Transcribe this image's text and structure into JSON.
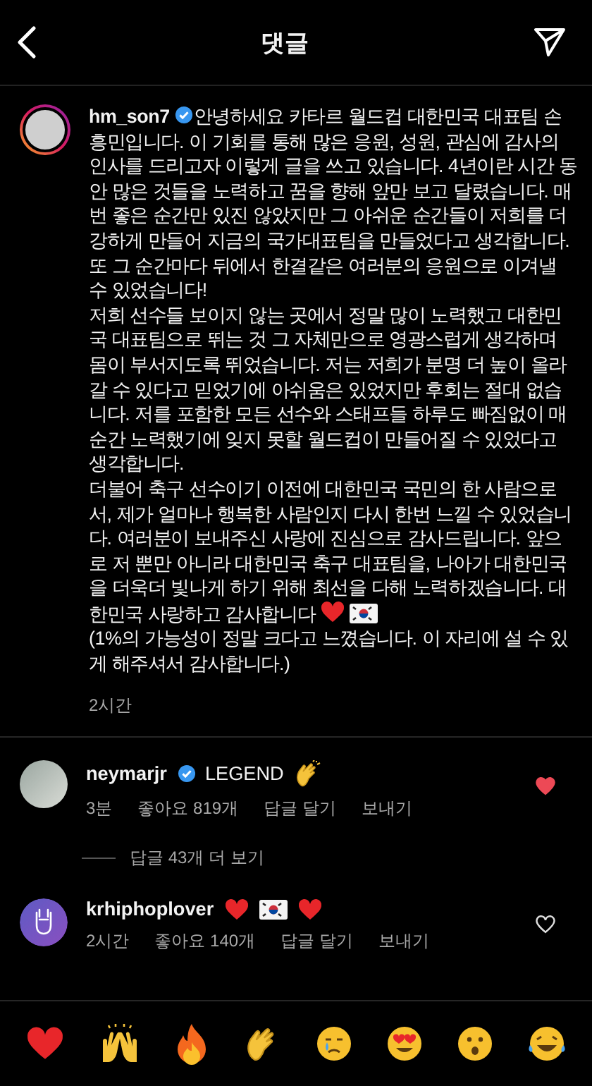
{
  "header": {
    "title": "댓글"
  },
  "post": {
    "username": "hm_son7",
    "verified": true,
    "paragraphs": [
      "안녕하세요 카타르 월드컵 대한민국 대표팀 손흥민입니다. 이 기회를 통해 많은 응원, 성원, 관심에 감사의 인사를 드리고자 이렇게 글을 쓰고 있습니다. 4년이란 시간 동안 많은 것들을 노력하고 꿈을 향해 앞만 보고 달렸습니다. 매번 좋은 순간만 있진 않았지만 그 아쉬운 순간들이 저희를 더 강하게 만들어 지금의 국가대표팀을 만들었다고 생각합니다. 또 그 순간마다 뒤에서 한결같은 여러분의 응원으로 이겨낼 수 있었습니다!",
      "저희 선수들 보이지 않는 곳에서 정말 많이 노력했고 대한민국 대표팀으로 뛰는 것 그 자체만으로 영광스럽게 생각하며 몸이 부서지도록 뛰었습니다. 저는 저희가 분명 더 높이 올라갈 수 있다고 믿었기에 아쉬움은 있었지만 후회는 절대 없습니다. 저를 포함한 모든 선수와 스태프들 하루도 빠짐없이 매 순간 노력했기에 잊지 못할 월드컵이 만들어질 수 있었다고 생각합니다.",
      "더불어 축구 선수이기 이전에 대한민국 국민의 한 사람으로서, 제가 얼마나 행복한 사람인지 다시 한번 느낄 수 있었습니다. 여러분이 보내주신 사랑에 진심으로 감사드립니다. 앞으로 저 뿐만 아니라 대한민국 축구 대표팀을, 나아가 대한민국을 더욱더 빛나게 하기 위해 최선을 다해 노력하겠습니다. 대한민국 사랑하고 감사합니다",
      "(1%의 가능성이 정말 크다고 느꼈습니다. 이 자리에 설 수 있게 해주셔서 감사합니다.)"
    ],
    "time": "2시간"
  },
  "comments": [
    {
      "username": "neymarjr",
      "verified": true,
      "text": "LEGEND",
      "time": "3분",
      "likes": "좋아요 819개",
      "reply": "답글 달기",
      "send": "보내기",
      "liked": true,
      "more_replies": "답글 43개 더 보기"
    },
    {
      "username": "krhiphoplover",
      "verified": false,
      "time": "2시간",
      "likes": "좋아요 140개",
      "reply": "답글 달기",
      "send": "보내기",
      "liked": false
    }
  ]
}
